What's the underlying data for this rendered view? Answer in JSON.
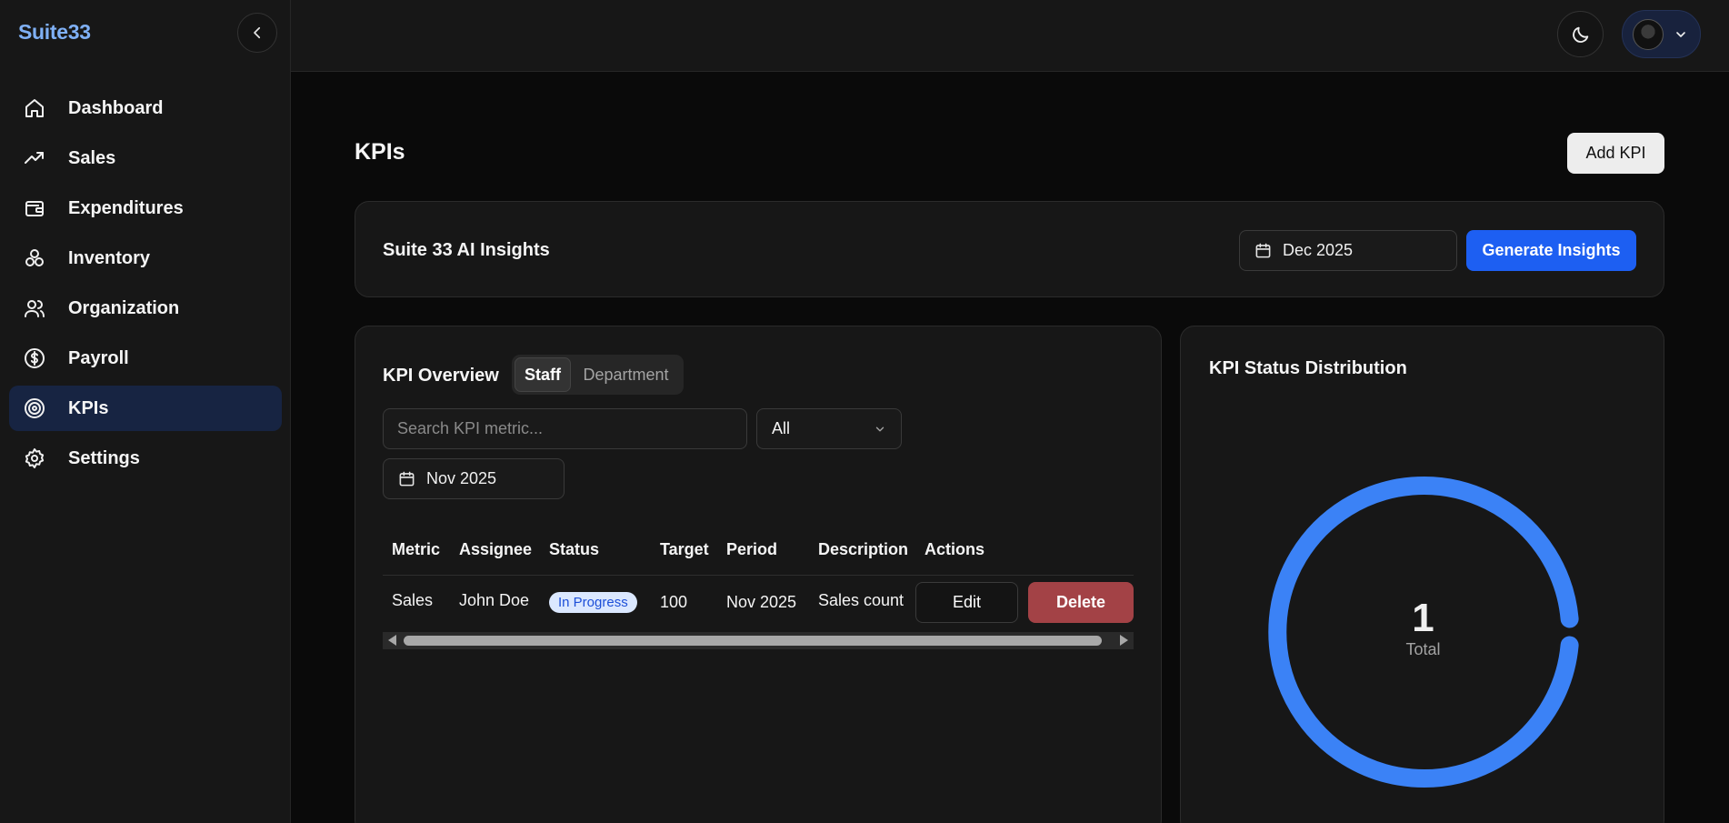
{
  "brand": "Suite33",
  "sidebar": {
    "items": [
      {
        "label": "Dashboard",
        "icon": "home-icon"
      },
      {
        "label": "Sales",
        "icon": "trending-up-icon"
      },
      {
        "label": "Expenditures",
        "icon": "wallet-icon"
      },
      {
        "label": "Inventory",
        "icon": "boxes-icon"
      },
      {
        "label": "Organization",
        "icon": "users-icon"
      },
      {
        "label": "Payroll",
        "icon": "dollar-circle-icon"
      },
      {
        "label": "KPIs",
        "icon": "target-icon",
        "active": true
      },
      {
        "label": "Settings",
        "icon": "gear-icon"
      }
    ]
  },
  "header": {
    "theme_icon": "moon-icon",
    "user_menu_icon": "chevron-down-icon"
  },
  "page": {
    "title": "KPIs",
    "add_button": "Add KPI"
  },
  "insights": {
    "title": "Suite 33 AI Insights",
    "date": "Dec 2025",
    "generate_button": "Generate Insights"
  },
  "overview": {
    "title": "KPI Overview",
    "tabs": [
      "Staff",
      "Department"
    ],
    "active_tab": "Staff",
    "search_placeholder": "Search KPI metric...",
    "filter_value": "All",
    "date": "Nov 2025",
    "columns": [
      "Metric",
      "Assignee",
      "Status",
      "Target",
      "Period",
      "Description",
      "Actions"
    ],
    "rows": [
      {
        "metric": "Sales",
        "assignee": "John Doe",
        "status": "In Progress",
        "target": "100",
        "period": "Nov 2025",
        "description": "Sales count",
        "edit": "Edit",
        "delete": "Delete"
      }
    ]
  },
  "distribution": {
    "title": "KPI Status Distribution",
    "total": "1",
    "total_label": "Total",
    "segments": [
      {
        "status": "In Progress",
        "count": 1,
        "color": "#3b82f6"
      }
    ]
  },
  "colors": {
    "accent": "#1d5ff2",
    "brand": "#7fb0f5",
    "delete": "#a34246",
    "donut": "#3b82f6"
  }
}
